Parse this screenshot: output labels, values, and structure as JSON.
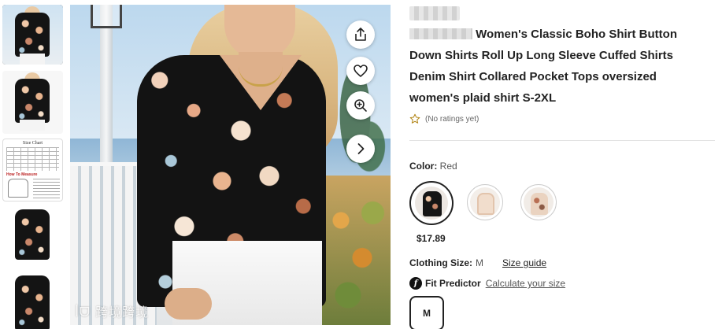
{
  "gallery": {
    "thumbnails": [
      {
        "label": "thumbnail-1",
        "selected": true
      },
      {
        "label": "thumbnail-2",
        "selected": false
      },
      {
        "label": "thumbnail-size-chart",
        "selected": false,
        "title": "Size Chart",
        "subtitle": "How To Measure"
      },
      {
        "label": "thumbnail-4",
        "selected": false
      },
      {
        "label": "thumbnail-5",
        "selected": false
      }
    ],
    "watermark": "跨境跨境",
    "buttons": {
      "share_icon": "share-icon",
      "favorite_icon": "heart-icon",
      "zoom_icon": "zoom-in-icon",
      "next_icon": "chevron-right-icon"
    }
  },
  "product": {
    "title": "Women's Classic Boho Shirt Button Down Shirts Roll Up Long Sleeve Cuffed Shirts Denim Shirt Collared Pocket Tops oversized women's plaid shirt S-2XL",
    "rating_text": "(No ratings yet)",
    "color_label": "Color:",
    "color_value": "Red",
    "swatches": [
      {
        "name": "Red",
        "selected": true
      },
      {
        "name": "Beige",
        "selected": false
      },
      {
        "name": "Floral",
        "selected": false
      }
    ],
    "price": "$17.89",
    "size_label": "Clothing Size:",
    "size_value": "M",
    "size_guide": "Size guide",
    "fit_label": "Fit Predictor",
    "fit_link": "Calculate your size",
    "size_options": [
      "M"
    ]
  },
  "colors": {
    "text": "#222222",
    "muted": "#555555",
    "divider": "#e3e3e3",
    "star": "#b58a1f"
  }
}
